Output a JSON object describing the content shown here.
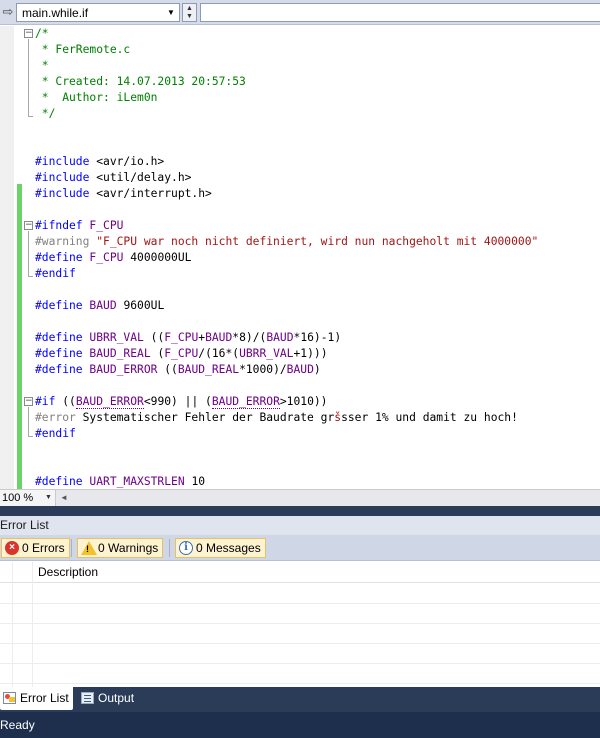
{
  "navbar": {
    "member_dropdown": "main.while.if"
  },
  "editor": {
    "lines": [
      [
        {
          "t": "/*",
          "c": "cm"
        }
      ],
      [
        {
          "t": " * FerRemote.c",
          "c": "cm"
        }
      ],
      [
        {
          "t": " *",
          "c": "cm"
        }
      ],
      [
        {
          "t": " * Created: 14.07.2013 20:57:53",
          "c": "cm"
        }
      ],
      [
        {
          "t": " *  Author: iLem0n",
          "c": "cm"
        }
      ],
      [
        {
          "t": " */",
          "c": "cm"
        }
      ],
      [],
      [],
      [
        {
          "t": "#include ",
          "c": "kw"
        },
        {
          "t": "<avr/io.h>",
          "c": ""
        }
      ],
      [
        {
          "t": "#include ",
          "c": "kw"
        },
        {
          "t": "<util/delay.h>",
          "c": ""
        }
      ],
      [
        {
          "t": "#include ",
          "c": "kw"
        },
        {
          "t": "<avr/interrupt.h>",
          "c": ""
        }
      ],
      [],
      [
        {
          "t": "#ifndef ",
          "c": "kw"
        },
        {
          "t": "F_CPU",
          "c": "mac"
        }
      ],
      [
        {
          "t": "#warning ",
          "c": "pre"
        },
        {
          "t": "\"F_CPU war noch nicht definiert, wird nun nachgeholt mit 4000000\"",
          "c": "str"
        }
      ],
      [
        {
          "t": "#define ",
          "c": "kw"
        },
        {
          "t": "F_CPU",
          "c": "mac"
        },
        {
          "t": " 4000000UL",
          "c": ""
        }
      ],
      [
        {
          "t": "#endif",
          "c": "kw"
        }
      ],
      [],
      [
        {
          "t": "#define ",
          "c": "kw"
        },
        {
          "t": "BAUD",
          "c": "mac"
        },
        {
          "t": " 9600UL",
          "c": ""
        }
      ],
      [],
      [
        {
          "t": "#define ",
          "c": "kw"
        },
        {
          "t": "UBRR_VAL",
          "c": "mac"
        },
        {
          "t": " ((",
          "c": ""
        },
        {
          "t": "F_CPU",
          "c": "mac"
        },
        {
          "t": "+",
          "c": ""
        },
        {
          "t": "BAUD",
          "c": "mac"
        },
        {
          "t": "*8)/(",
          "c": ""
        },
        {
          "t": "BAUD",
          "c": "mac"
        },
        {
          "t": "*16)-1)",
          "c": ""
        }
      ],
      [
        {
          "t": "#define ",
          "c": "kw"
        },
        {
          "t": "BAUD_REAL",
          "c": "mac"
        },
        {
          "t": " (",
          "c": ""
        },
        {
          "t": "F_CPU",
          "c": "mac"
        },
        {
          "t": "/(16*(",
          "c": ""
        },
        {
          "t": "UBRR_VAL",
          "c": "mac"
        },
        {
          "t": "+1)))",
          "c": ""
        }
      ],
      [
        {
          "t": "#define ",
          "c": "kw"
        },
        {
          "t": "BAUD_ERROR",
          "c": "mac"
        },
        {
          "t": " ((",
          "c": ""
        },
        {
          "t": "BAUD_REAL",
          "c": "mac"
        },
        {
          "t": "*1000)/",
          "c": ""
        },
        {
          "t": "BAUD",
          "c": "mac"
        },
        {
          "t": ")",
          "c": ""
        }
      ],
      [],
      [
        {
          "t": "#if ",
          "c": "kw"
        },
        {
          "t": "((",
          "c": ""
        },
        {
          "t": "BAUD_ERROR",
          "c": "mac ob"
        },
        {
          "t": "<990) || (",
          "c": ""
        },
        {
          "t": "BAUD_ERROR",
          "c": "mac ob"
        },
        {
          "t": ">1010))",
          "c": ""
        }
      ],
      [
        {
          "t": "#error ",
          "c": "pre"
        },
        {
          "t": "Systematischer Fehler der Baudrate gr",
          "c": ""
        },
        {
          "t": "š",
          "c": "str"
        },
        {
          "t": "sser 1% und damit zu hoch!",
          "c": ""
        }
      ],
      [
        {
          "t": "#endif",
          "c": "kw"
        }
      ],
      [],
      [],
      [
        {
          "t": "#define ",
          "c": "kw"
        },
        {
          "t": "UART_MAXSTRLEN",
          "c": "mac"
        },
        {
          "t": " 10",
          "c": ""
        }
      ]
    ]
  },
  "zoom": "100 %",
  "error_list": {
    "title": "Error List",
    "errors_label": "0 Errors",
    "warnings_label": "0 Warnings",
    "messages_label": "0 Messages",
    "column_description": "Description"
  },
  "tabs": {
    "error_list": "Error List",
    "output": "Output"
  },
  "status": "Ready",
  "colors": {
    "comment": "#008000",
    "keyword": "#0000ff",
    "macro": "#6f008a",
    "string": "#a31515",
    "change_bar": "#6ad36a",
    "panel_dark": "#2b3c59"
  }
}
